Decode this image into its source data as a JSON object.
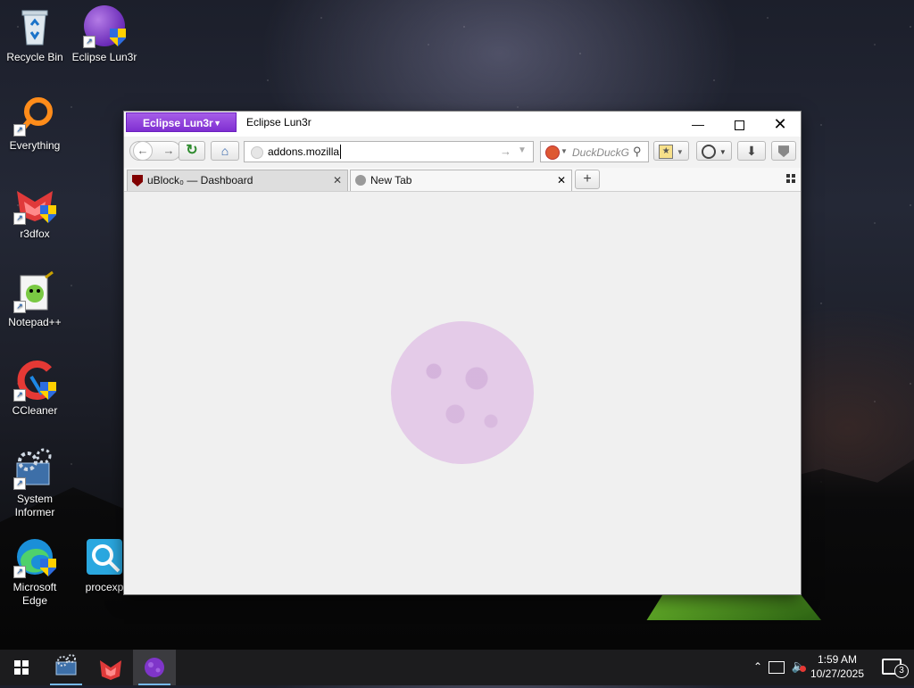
{
  "desktop": {
    "icons": [
      {
        "label": "Recycle Bin"
      },
      {
        "label": "Eclipse Lun3r"
      },
      {
        "label": "Everything"
      },
      {
        "label": "r3dfox"
      },
      {
        "label": "Notepad++"
      },
      {
        "label": "CCleaner"
      },
      {
        "label": "System Informer"
      },
      {
        "label": "Microsoft Edge"
      },
      {
        "label": "procexp"
      }
    ]
  },
  "browser": {
    "app_menu_label": "Eclipse Lun3r",
    "window_title": "Eclipse Lun3r",
    "url_value": "addons.mozilla",
    "search_placeholder": "DuckDuckG",
    "tabs": [
      {
        "label": "uBlock₀ — Dashboard",
        "active": false
      },
      {
        "label": "New Tab",
        "active": true
      }
    ]
  },
  "taskbar": {
    "time": "1:59 AM",
    "date": "10/27/2025",
    "notification_count": "3"
  },
  "colors": {
    "accent": "#8a3bdc",
    "taskbar": "#1c1c1e",
    "content_bg": "#f0f0f0",
    "moon": "#e4cbe8"
  }
}
